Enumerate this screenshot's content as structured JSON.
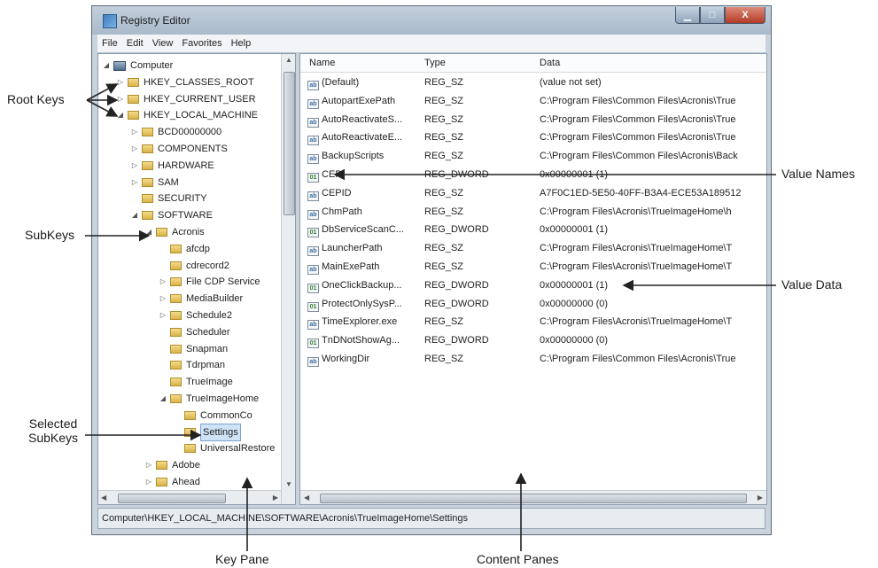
{
  "window": {
    "title": "Registry Editor",
    "minimize_glyph": "▁",
    "maximize_glyph": "□",
    "close_glyph": "X"
  },
  "menu": [
    "File",
    "Edit",
    "View",
    "Favorites",
    "Help"
  ],
  "tree": [
    {
      "label": "Computer",
      "toggle": "◢",
      "icon": "computer-icon"
    },
    {
      "label": "HKEY_CLASSES_ROOT",
      "toggle": "▷",
      "icon": "folder-icon"
    },
    {
      "label": "HKEY_CURRENT_USER",
      "toggle": "▷",
      "icon": "folder-icon"
    },
    {
      "label": "HKEY_LOCAL_MACHINE",
      "toggle": "◢",
      "icon": "folder-icon"
    },
    {
      "label": "BCD00000000",
      "toggle": "▷",
      "icon": "folder-icon"
    },
    {
      "label": "COMPONENTS",
      "toggle": "▷",
      "icon": "folder-icon"
    },
    {
      "label": "HARDWARE",
      "toggle": "▷",
      "icon": "folder-icon"
    },
    {
      "label": "SAM",
      "toggle": "▷",
      "icon": "folder-icon"
    },
    {
      "label": "SECURITY",
      "toggle": "",
      "icon": "folder-icon"
    },
    {
      "label": "SOFTWARE",
      "toggle": "◢",
      "icon": "folder-icon"
    },
    {
      "label": "Acronis",
      "toggle": "◢",
      "icon": "folder-icon"
    },
    {
      "label": "afcdp",
      "toggle": "",
      "icon": "folder-icon"
    },
    {
      "label": "cdrecord2",
      "toggle": "",
      "icon": "folder-icon"
    },
    {
      "label": "File CDP Service",
      "toggle": "▷",
      "icon": "folder-icon"
    },
    {
      "label": "MediaBuilder",
      "toggle": "▷",
      "icon": "folder-icon"
    },
    {
      "label": "Schedule2",
      "toggle": "▷",
      "icon": "folder-icon"
    },
    {
      "label": "Scheduler",
      "toggle": "",
      "icon": "folder-icon"
    },
    {
      "label": "Snapman",
      "toggle": "",
      "icon": "folder-icon"
    },
    {
      "label": "Tdrpman",
      "toggle": "",
      "icon": "folder-icon"
    },
    {
      "label": "TrueImage",
      "toggle": "",
      "icon": "folder-icon"
    },
    {
      "label": "TrueImageHome",
      "toggle": "◢",
      "icon": "folder-icon"
    },
    {
      "label": "CommonCo",
      "toggle": "",
      "icon": "folder-icon"
    },
    {
      "label": "Settings",
      "toggle": "",
      "icon": "folder-icon",
      "selected": true
    },
    {
      "label": "UniversalRestore",
      "toggle": "",
      "icon": "folder-icon"
    },
    {
      "label": "Adobe",
      "toggle": "▷",
      "icon": "folder-icon"
    },
    {
      "label": "Ahead",
      "toggle": "▷",
      "icon": "folder-icon"
    }
  ],
  "list": {
    "columns": [
      "Name",
      "Type",
      "Data"
    ],
    "rows": [
      {
        "name": "(Default)",
        "type": "REG_SZ",
        "data": "(value not set)",
        "icon": "string-value-icon"
      },
      {
        "name": "AutopartExePath",
        "type": "REG_SZ",
        "data": "C:\\Program Files\\Common Files\\Acronis\\True",
        "icon": "string-value-icon"
      },
      {
        "name": "AutoReactivateS...",
        "type": "REG_SZ",
        "data": "C:\\Program Files\\Common Files\\Acronis\\True",
        "icon": "string-value-icon"
      },
      {
        "name": "AutoReactivateE...",
        "type": "REG_SZ",
        "data": "C:\\Program Files\\Common Files\\Acronis\\True",
        "icon": "string-value-icon"
      },
      {
        "name": "BackupScripts",
        "type": "REG_SZ",
        "data": "C:\\Program Files\\Common Files\\Acronis\\Back",
        "icon": "string-value-icon"
      },
      {
        "name": "CEP",
        "type": "REG_DWORD",
        "data": "0x00000001 (1)",
        "icon": "binary-value-icon"
      },
      {
        "name": "CEPID",
        "type": "REG_SZ",
        "data": "A7F0C1ED-5E50-40FF-B3A4-ECE53A189512",
        "icon": "string-value-icon"
      },
      {
        "name": "ChmPath",
        "type": "REG_SZ",
        "data": "C:\\Program Files\\Acronis\\TrueImageHome\\h",
        "icon": "string-value-icon"
      },
      {
        "name": "DbServiceScanC...",
        "type": "REG_DWORD",
        "data": "0x00000001 (1)",
        "icon": "binary-value-icon"
      },
      {
        "name": "LauncherPath",
        "type": "REG_SZ",
        "data": "C:\\Program Files\\Acronis\\TrueImageHome\\T",
        "icon": "string-value-icon"
      },
      {
        "name": "MainExePath",
        "type": "REG_SZ",
        "data": "C:\\Program Files\\Acronis\\TrueImageHome\\T",
        "icon": "string-value-icon"
      },
      {
        "name": "OneClickBackup...",
        "type": "REG_DWORD",
        "data": "0x00000001 (1)",
        "icon": "binary-value-icon"
      },
      {
        "name": "ProtectOnlySysP...",
        "type": "REG_DWORD",
        "data": "0x00000000 (0)",
        "icon": "binary-value-icon"
      },
      {
        "name": "TimeExplorer.exe",
        "type": "REG_SZ",
        "data": "C:\\Program Files\\Acronis\\TrueImageHome\\T",
        "icon": "string-value-icon"
      },
      {
        "name": "TnDNotShowAg...",
        "type": "REG_DWORD",
        "data": "0x00000000 (0)",
        "icon": "binary-value-icon"
      },
      {
        "name": "WorkingDir",
        "type": "REG_SZ",
        "data": "C:\\Program Files\\Common Files\\Acronis\\True",
        "icon": "string-value-icon"
      }
    ],
    "string_icon_glyph": "ab",
    "binary_icon_glyph": "01"
  },
  "statusbar": "Computer\\HKEY_LOCAL_MACHINE\\SOFTWARE\\Acronis\\TrueImageHome\\Settings",
  "annotations": {
    "root_keys": "Root Keys",
    "subkeys": "SubKeys",
    "selected_subkeys_line1": "Selected",
    "selected_subkeys_line2": "SubKeys",
    "value_names": "Value Names",
    "value_data": "Value Data",
    "key_pane": "Key Pane",
    "content_panes": "Content Panes"
  },
  "colors": {
    "arrow": "#222222",
    "selection": "#cfe3f7"
  }
}
